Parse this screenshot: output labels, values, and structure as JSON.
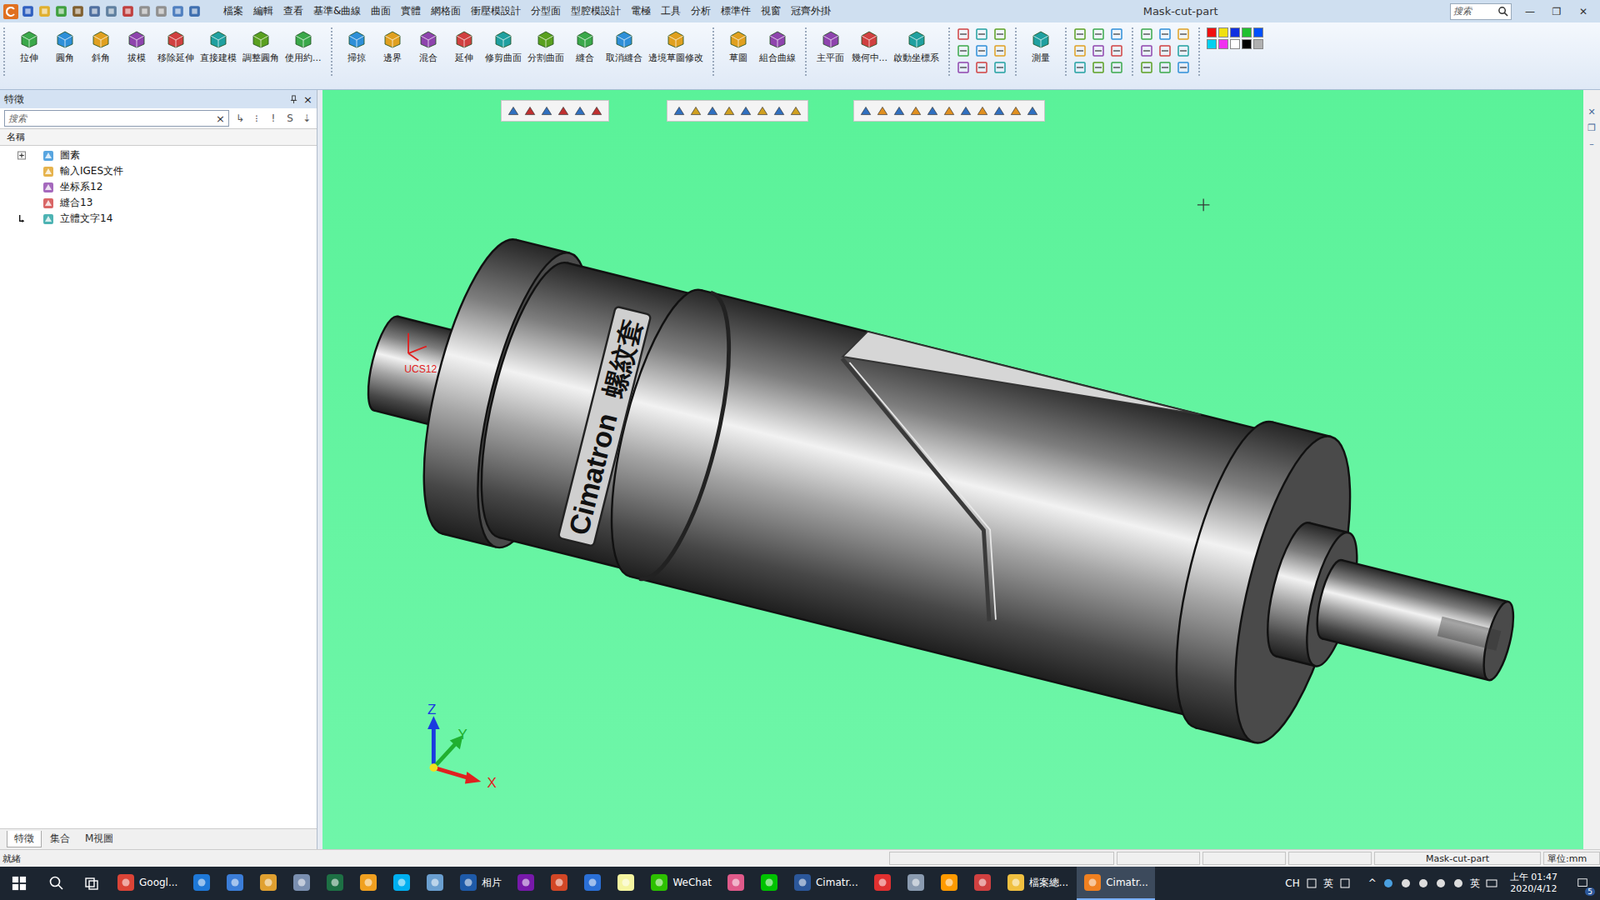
{
  "window": {
    "title": "Mask-cut-part",
    "controls": [
      "—",
      "❐",
      "✕"
    ]
  },
  "search": {
    "placeholder": "搜索"
  },
  "menu": [
    "檔案",
    "編輯",
    "查看",
    "基準&曲線",
    "曲面",
    "實體",
    "網格面",
    "衝壓模設計",
    "分型面",
    "型腔模設計",
    "電極",
    "工具",
    "分析",
    "標準件",
    "視窗",
    "冠齊外掛"
  ],
  "ribbon": [
    {
      "kind": "buttons",
      "buttons": [
        "拉伸",
        "圓角",
        "斜角",
        "拔模",
        "移除延伸",
        "直接建模",
        "調整圓角",
        "使用約..."
      ]
    },
    {
      "kind": "buttons",
      "buttons": [
        "掃掠",
        "邊界",
        "混合",
        "延伸",
        "修剪曲面",
        "分割曲面",
        "縫合",
        "取消縫合",
        "邊境草圖修改"
      ]
    },
    {
      "kind": "buttons",
      "buttons": [
        "草圖",
        "組合曲線"
      ]
    },
    {
      "kind": "buttons",
      "buttons": [
        "主平面",
        "幾何中...",
        "啟動坐標系"
      ]
    },
    {
      "kind": "tools"
    },
    {
      "kind": "buttons",
      "buttons": [
        "測量"
      ]
    },
    {
      "kind": "tools"
    },
    {
      "kind": "tools"
    },
    {
      "kind": "palette",
      "colors": [
        "#f01010",
        "#f0e010",
        "#1030e0",
        "#20c030",
        "#0050ff",
        "#00d0f0",
        "#f030f0",
        "#ffffff",
        "#000000",
        "#b0b0b0"
      ]
    }
  ],
  "feature_panel": {
    "title": "特徵",
    "close": "×",
    "search_placeholder": "搜索",
    "clear": "×",
    "filters": [
      "↳",
      "⁝",
      "!",
      "S",
      "⇣"
    ],
    "column": "名稱",
    "tree": [
      {
        "label": "圖素",
        "expandable": true,
        "expanded": false,
        "current": false
      },
      {
        "label": "輸入IGES文件",
        "expandable": false,
        "expanded": false,
        "current": false
      },
      {
        "label": "坐标系12",
        "expandable": false,
        "expanded": false,
        "current": false
      },
      {
        "label": "縫合13",
        "expandable": false,
        "expanded": false,
        "current": false
      },
      {
        "label": "立體文字14",
        "expandable": false,
        "expanded": false,
        "current": true
      }
    ],
    "tabs": [
      {
        "label": "特徵",
        "selected": true
      },
      {
        "label": "集合",
        "selected": false
      },
      {
        "label": "M視圖",
        "selected": false
      }
    ]
  },
  "side_controls": [
    "✕",
    "❐",
    "–"
  ],
  "viewport": {
    "model_text": [
      "Cimatron",
      "螺紋套"
    ],
    "ucs_label": "UCS12",
    "axes": {
      "x": "X",
      "y": "Y",
      "z": "Z"
    }
  },
  "status_bar": {
    "message": "就緒",
    "document": "Mask-cut-part",
    "units": "單位:mm"
  },
  "taskbar": {
    "apps": [
      {
        "label": "Googl...",
        "color": "#db4437",
        "selected": false
      },
      {
        "label": "",
        "color": "#1e78d7",
        "selected": false
      },
      {
        "label": "",
        "color": "#3b7dd8",
        "selected": false
      },
      {
        "label": "",
        "color": "#e0a030",
        "selected": false
      },
      {
        "label": "",
        "color": "#7a8fb0",
        "selected": false
      },
      {
        "label": "",
        "color": "#1d7044",
        "selected": false
      },
      {
        "label": "",
        "color": "#f0a020",
        "selected": false
      },
      {
        "label": "",
        "color": "#00aff0",
        "selected": false
      },
      {
        "label": "",
        "color": "#6a9fd0",
        "selected": false
      },
      {
        "label": "相片",
        "color": "#1e5aa8",
        "selected": false
      },
      {
        "label": "",
        "color": "#7719aa",
        "selected": false
      },
      {
        "label": "",
        "color": "#d24726",
        "selected": false
      },
      {
        "label": "",
        "color": "#2a6fd6",
        "selected": false
      },
      {
        "label": "",
        "color": "#f5f5a0",
        "selected": false
      },
      {
        "label": "WeChat",
        "color": "#2dc100",
        "selected": false
      },
      {
        "label": "",
        "color": "#e05a8a",
        "selected": false
      },
      {
        "label": "",
        "color": "#00c300",
        "selected": false
      },
      {
        "label": "Cimatr...",
        "color": "#2b579a",
        "selected": false
      },
      {
        "label": "",
        "color": "#e03030",
        "selected": false
      },
      {
        "label": "",
        "color": "#8a9bb0",
        "selected": false
      },
      {
        "label": "",
        "color": "#ff9a00",
        "selected": false
      },
      {
        "label": "",
        "color": "#d04040",
        "selected": false
      },
      {
        "label": "檔案總...",
        "color": "#f0c040",
        "selected": false
      },
      {
        "label": "Cimatr...",
        "color": "#f08020",
        "selected": true
      }
    ],
    "tray_labels": [
      "CH",
      "英"
    ],
    "chevron": "^",
    "ime": "英",
    "time": "上午 01:47",
    "date": "2020/4/12",
    "notifications": "5"
  }
}
